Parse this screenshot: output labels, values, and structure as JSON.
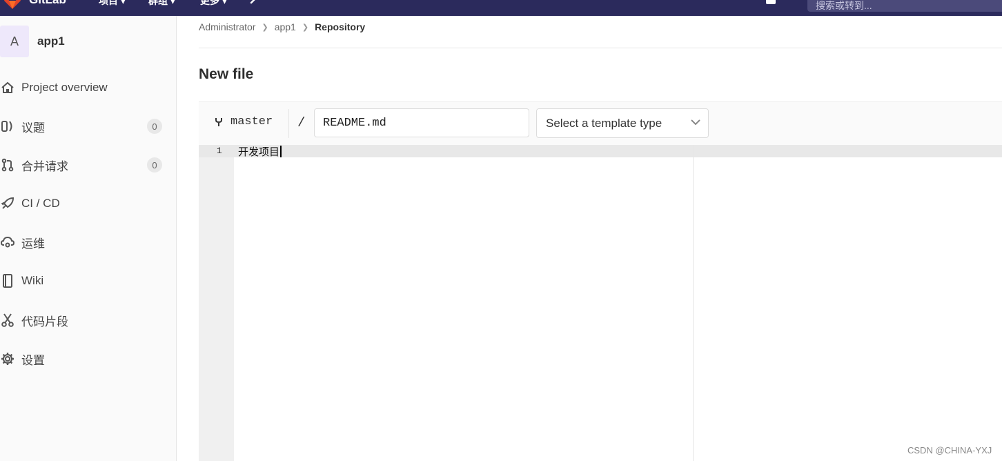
{
  "topbar": {
    "brand": "GitLab",
    "nav": [
      {
        "label": "项目 ▾"
      },
      {
        "label": "群组 ▾"
      },
      {
        "label": "更多 ▾"
      }
    ],
    "search_placeholder": "搜索或转到...",
    "colors": {
      "background": "#2b2a5c",
      "search": "#4b4a7a"
    }
  },
  "sidebar": {
    "project_avatar": "A",
    "project_name": "app1",
    "items": [
      {
        "label": "Project overview",
        "icon": "home-icon"
      },
      {
        "label": "议题",
        "icon": "issues-icon",
        "badge": "0"
      },
      {
        "label": "合并请求",
        "icon": "merge-request-icon",
        "badge": "0"
      },
      {
        "label": "CI / CD",
        "icon": "rocket-icon"
      },
      {
        "label": "运维",
        "icon": "cloud-gear-icon"
      },
      {
        "label": "Wiki",
        "icon": "book-icon"
      },
      {
        "label": "代码片段",
        "icon": "scissors-icon"
      },
      {
        "label": "设置",
        "icon": "gear-icon"
      }
    ]
  },
  "breadcrumb": {
    "items": [
      "Administrator",
      "app1",
      "Repository"
    ]
  },
  "page": {
    "title": "New file"
  },
  "editor": {
    "branch": "master",
    "separator": "/",
    "file_name": "README.md",
    "template_placeholder": "Select a template type",
    "lines": [
      {
        "number": "1",
        "text": "开发项目"
      }
    ]
  },
  "watermark": "CSDN @CHINA-YXJ"
}
